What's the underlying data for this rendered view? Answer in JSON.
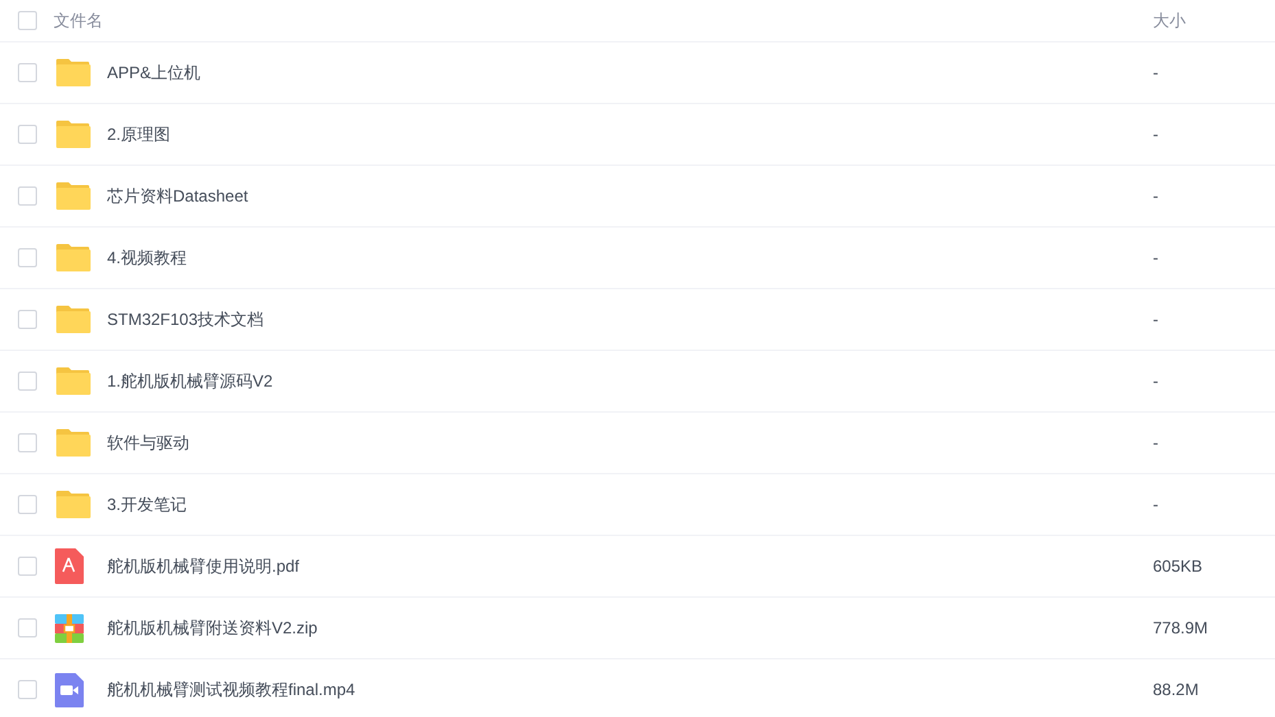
{
  "header": {
    "checked": false,
    "name_column": "文件名",
    "size_column": "大小"
  },
  "rows": [
    {
      "kind": "folder",
      "name": "APP&上位机",
      "size": "-",
      "checked": false
    },
    {
      "kind": "folder",
      "name": "2.原理图",
      "size": "-",
      "checked": false
    },
    {
      "kind": "folder",
      "name": "芯片资料Datasheet",
      "size": "-",
      "checked": false
    },
    {
      "kind": "folder",
      "name": "4.视频教程",
      "size": "-",
      "checked": false
    },
    {
      "kind": "folder",
      "name": "STM32F103技术文档",
      "size": "-",
      "checked": false
    },
    {
      "kind": "folder",
      "name": "1.舵机版机械臂源码V2",
      "size": "-",
      "checked": false
    },
    {
      "kind": "folder",
      "name": "软件与驱动",
      "size": "-",
      "checked": false
    },
    {
      "kind": "folder",
      "name": "3.开发笔记",
      "size": "-",
      "checked": false
    },
    {
      "kind": "pdf",
      "name": "舵机版机械臂使用说明.pdf",
      "size": "605KB",
      "checked": false
    },
    {
      "kind": "zip",
      "name": "舵机版机械臂附送资料V2.zip",
      "size": "778.9M",
      "checked": false
    },
    {
      "kind": "video",
      "name": "舵机机械臂测试视频教程final.mp4",
      "size": "88.2M",
      "checked": false
    }
  ]
}
